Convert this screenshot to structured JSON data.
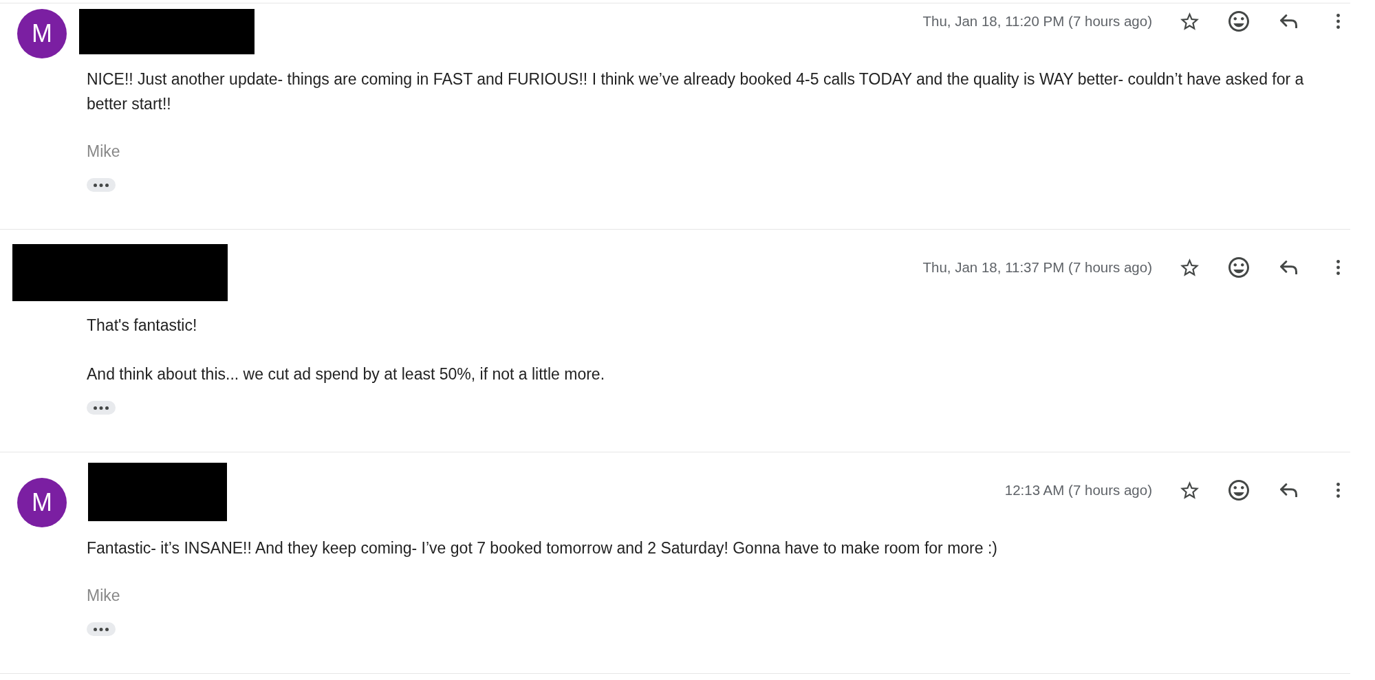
{
  "messages": [
    {
      "avatar": {
        "initial": "M"
      },
      "sender_redacted": true,
      "date": "Thu, Jan 18, 11:20 PM (7 hours ago)",
      "starred": false,
      "body": [
        "NICE!! Just another update- things are coming in FAST and FURIOUS!! I think we’ve already booked 4-5 calls TODAY and the quality is WAY better- couldn’t have asked for a better start!!"
      ],
      "signature": "Mike"
    },
    {
      "sender_redacted": true,
      "date": "Thu, Jan 18, 11:37 PM (7 hours ago)",
      "starred": false,
      "body": [
        "That's fantastic!",
        "And think about this... we cut ad spend by at least 50%, if not a little more."
      ]
    },
    {
      "avatar": {
        "initial": "M"
      },
      "sender_redacted": true,
      "date": "12:13 AM (7 hours ago)",
      "starred": false,
      "body": [
        "Fantastic- it’s INSANE!! And they keep coming- I’ve got 7 booked tomorrow and 2 Saturday! Gonna have to make room for more :)"
      ],
      "signature": "Mike"
    }
  ]
}
